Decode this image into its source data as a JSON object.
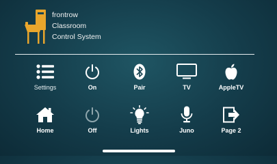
{
  "brand": {
    "line1": "frontrow",
    "line2": "Classroom",
    "line3": "Control System",
    "accent_color": "#e9a62c"
  },
  "tiles": [
    {
      "label": "Settings",
      "icon": "list-icon"
    },
    {
      "label": "On",
      "icon": "power-icon"
    },
    {
      "label": "Pair",
      "icon": "bluetooth-icon"
    },
    {
      "label": "TV",
      "icon": "tv-icon"
    },
    {
      "label": "AppleTV",
      "icon": "apple-icon"
    },
    {
      "label": "Home",
      "icon": "home-icon"
    },
    {
      "label": "Off",
      "icon": "power-off-icon"
    },
    {
      "label": "Lights",
      "icon": "lightbulb-icon"
    },
    {
      "label": "Juno",
      "icon": "microphone-icon"
    },
    {
      "label": "Page 2",
      "icon": "page-next-icon"
    }
  ]
}
